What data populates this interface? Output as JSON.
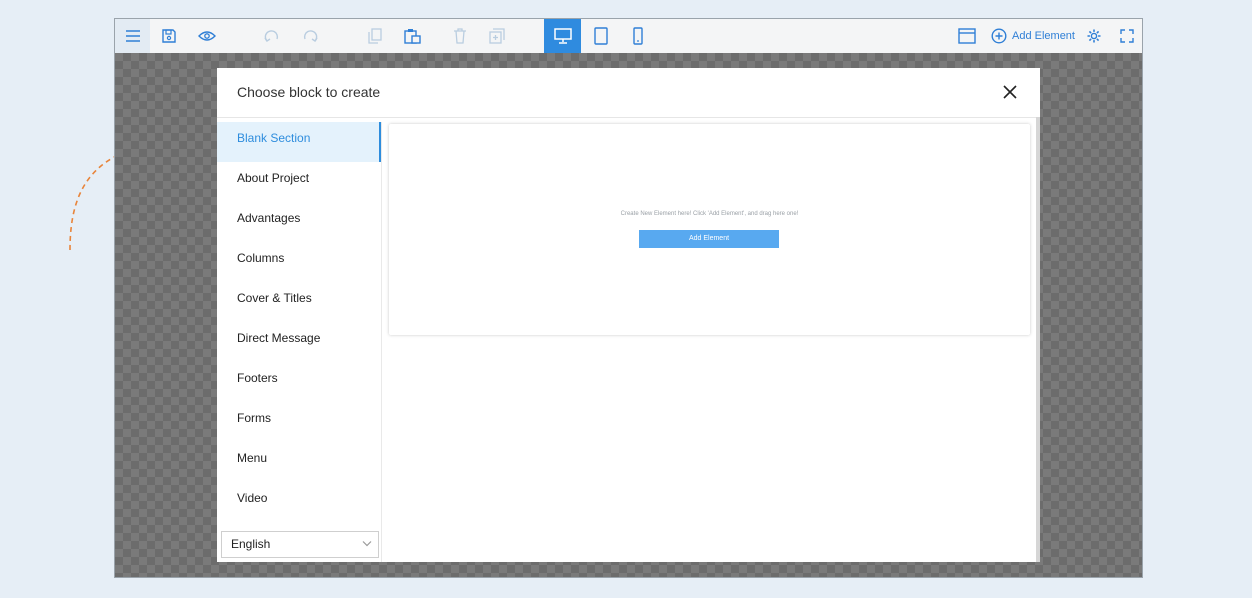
{
  "toolbar": {
    "add_element_label": "Add Element",
    "icons": [
      "menu-icon",
      "save-icon",
      "preview-eye-icon",
      "undo-icon",
      "redo-icon",
      "copy-icon",
      "paste-icon",
      "delete-icon",
      "duplicate-icon",
      "desktop-icon",
      "tablet-icon",
      "mobile-icon",
      "layout-icon",
      "add-circle-icon",
      "settings-gear-icon",
      "fullscreen-icon"
    ]
  },
  "modal": {
    "title": "Choose block to create",
    "categories": [
      {
        "label": "Blank Section",
        "active": true
      },
      {
        "label": "About Project"
      },
      {
        "label": "Advantages"
      },
      {
        "label": "Columns"
      },
      {
        "label": "Cover & Titles"
      },
      {
        "label": "Direct Message"
      },
      {
        "label": "Footers"
      },
      {
        "label": "Forms"
      },
      {
        "label": "Menu"
      },
      {
        "label": "Video"
      }
    ],
    "language": "English",
    "preview": {
      "hint": "Create New Element here! Click 'Add Element', and drag here one!",
      "button_label": "Add Element"
    }
  },
  "colors": {
    "accent": "#2f8bdf",
    "background": "#e6eef6",
    "decoration": "#e8843a"
  }
}
